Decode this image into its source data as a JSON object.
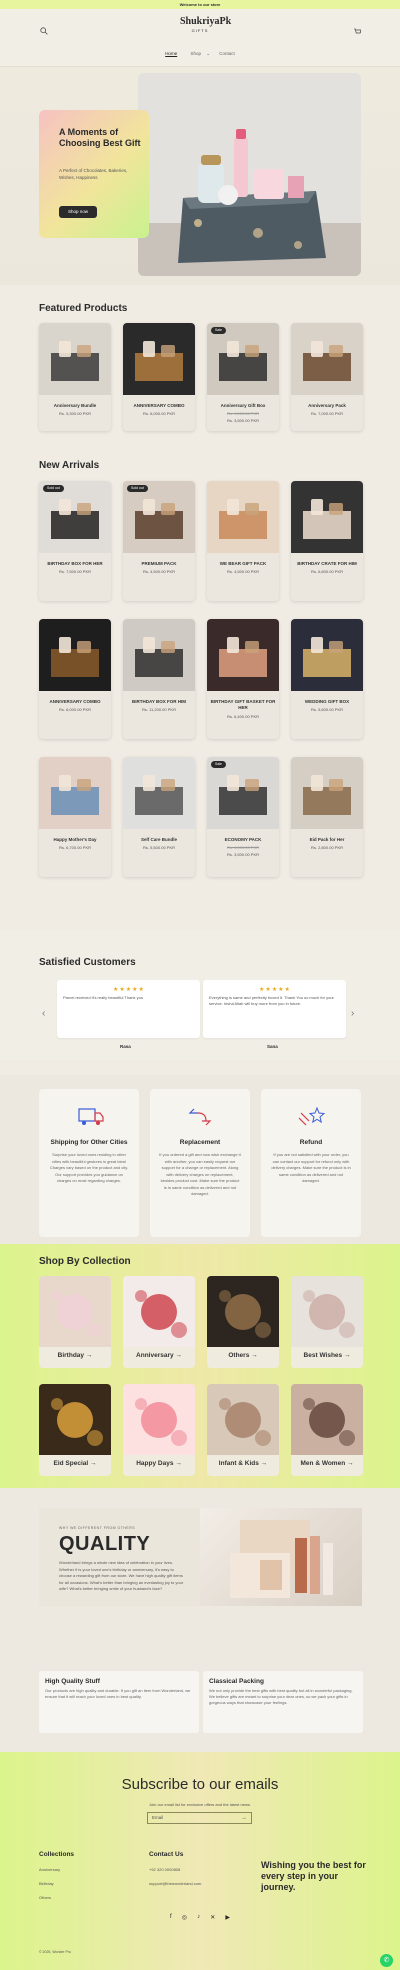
{
  "announcement": "Welcome to our store",
  "header": {
    "logo_line1": "ShukriyaPk",
    "logo_line2": "GIFTS",
    "nav": [
      "Home",
      "Shop",
      "Contact"
    ]
  },
  "hero": {
    "title": "A Moments of Choosing Best Gift",
    "text": "A Perfect of Chocolates, Bakeries, Wishes, Happiness",
    "button": "Shop now"
  },
  "featured": {
    "title": "Featured Products",
    "items": [
      {
        "name": "Anniversary Bundle",
        "price": "Rs. 9,300.00 PKR",
        "old": "",
        "badge": ""
      },
      {
        "name": "ANNIVERSARY COMBO",
        "price": "Rs. 6,000.00 PKR",
        "old": "",
        "badge": ""
      },
      {
        "name": "Anniversary Gift Box",
        "price": "Rs. 3,500.00 PKR",
        "old": "Rs. 4,500.00 PKR",
        "badge": "Sale"
      },
      {
        "name": "Anniversary Pack",
        "price": "Rs. 7,000.00 PKR",
        "old": "",
        "badge": ""
      }
    ]
  },
  "arrivals": {
    "title": "New Arrivals",
    "items": [
      {
        "name": "BIRTHDAY BOX FOR HER",
        "price": "Rs. 7,500.00 PKR",
        "old": "",
        "badge": "Sold out"
      },
      {
        "name": "PREMIUM PACK",
        "price": "Rs. 4,500.00 PKR",
        "old": "",
        "badge": "Sold out"
      },
      {
        "name": "WE BEAR GIFT PACK",
        "price": "Rs. 4,500.00 PKR",
        "old": "",
        "badge": ""
      },
      {
        "name": "BIRTHDAY CRATE FOR HIM",
        "price": "Rs. 6,800.00 PKR",
        "old": "",
        "badge": ""
      },
      {
        "name": "ANNIVERSARY COMBO",
        "price": "Rs. 6,000.00 PKR",
        "old": "",
        "badge": ""
      },
      {
        "name": "BIRTHDAY BOX FOR HIM",
        "price": "Rs. 11,200.00 PKR",
        "old": "",
        "badge": ""
      },
      {
        "name": "BIRTHDAY GIFT BASKET FOR HER",
        "price": "Rs. 6,400.00 PKR",
        "old": "",
        "badge": ""
      },
      {
        "name": "WEDDING GIFT BOX",
        "price": "Rs. 5,600.00 PKR",
        "old": "",
        "badge": ""
      },
      {
        "name": "Happy Mother's Day",
        "price": "Rs. 6,700.00 PKR",
        "old": "",
        "badge": ""
      },
      {
        "name": "Self Care Bundle",
        "price": "Rs. 5,500.00 PKR",
        "old": "",
        "badge": ""
      },
      {
        "name": "ECONOMY PACK",
        "price": "Rs. 3,500.00 PKR",
        "old": "Rs. 4,000.00 PKR",
        "badge": "Sale"
      },
      {
        "name": "Eid Pack for Her",
        "price": "Rs. 2,800.00 PKR",
        "old": "",
        "badge": ""
      }
    ]
  },
  "customers": {
    "title": "Satisfied Customers",
    "reviews": [
      {
        "text": "Parcel received it's really beautiful Thank you",
        "name": "Rasa",
        "stars": "★★★★★"
      },
      {
        "text": "Everything is same and perfectly boxed it. Thank You so much for your service. Insha'Allah will buy more from you in future.",
        "name": "Sana",
        "stars": "★★★★★"
      }
    ]
  },
  "features": [
    {
      "title": "Shipping for Other Cities",
      "text": "Surprise your loved ones residing in other cities with beautiful gestures is great idea! Charges vary based on the product and city. Our support provides you guidance on charges on most regarding charges."
    },
    {
      "title": "Replacement",
      "text": "If you ordered a gift and now wish exchange it with another, you can easily request our support for a change or replacement. Along with delivery charges on replacement, besides product cost. Make sure the product is in same condition as delivered and not damaged."
    },
    {
      "title": "Refund",
      "text": "If you are not satisfied with your order, you can contact our support for refund only with delivery charges. Make sure the product is in same condition as delivered and not damaged."
    }
  ],
  "collections": {
    "title": "Shop By Collection",
    "items": [
      "Birthday →",
      "Anniversary →",
      "Others →",
      "Best Wishes →",
      "Eid Special →",
      "Happy Days →",
      "Infant & Kids →",
      "Men & Women →"
    ]
  },
  "quality": {
    "kicker": "WHY WE DIFFERENT FROM OTHERS",
    "title": "QUALITY",
    "text": "Wonderland brings a whole new idea of celebration in your lives. Whether it is your loved one's birthday or anniversary, it's easy to choose a rewarding gift from our store. We have high quality gift items for all occasions. What's better than bringing an everlasting joy to your wife? What's better bringing smile of your husband's face?"
  },
  "info": [
    {
      "title": "High Quality Stuff",
      "text": "Our products are high quality and durable. If you gift an item from Wonderland, we ensure that it will reach your loved ones in best quality."
    },
    {
      "title": "Classical Packing",
      "text": "We not only provide the best gifts with best quality but all in wonderful packaging. We believe gifts are meant to surprise your dear ones, so we pack your gifts in gorgeous ways that showcase your feelings."
    }
  ],
  "footer": {
    "title": "Subscribe to our emails",
    "sub": "Join our email list for exclusive offers and the latest news.",
    "placeholder": "Email",
    "collections_title": "Collections",
    "collections": [
      "Anniversary",
      "Birthday",
      "Others"
    ],
    "contact_title": "Contact Us",
    "phone": "+92 320 0000808",
    "email": "support@thewonderland.com",
    "wish": "Wishing you the best for every step in your journey.",
    "copyright": "© 2025, Wonder Pro"
  },
  "colors": {
    "accent": "#e6f59e",
    "dark": "#2b2b2b",
    "star": "#e8a91c",
    "whatsapp": "#25d366"
  }
}
